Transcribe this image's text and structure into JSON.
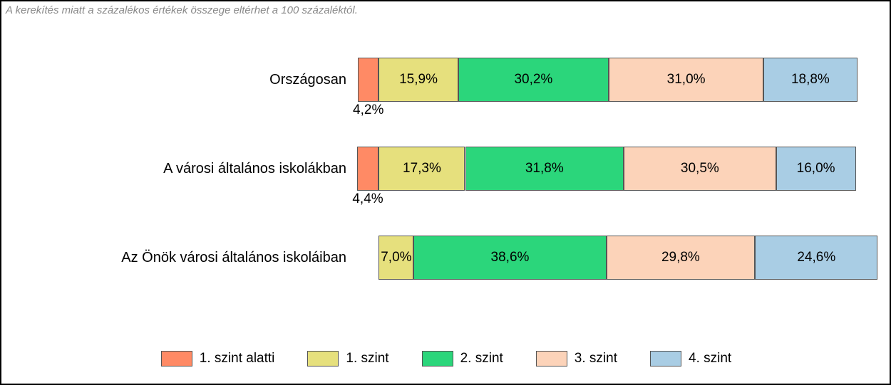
{
  "chart_data": {
    "type": "bar",
    "stacked": true,
    "orientation": "horizontal",
    "note": "A kerekítés miatt a százalékos értékek összege eltérhet a 100 százaléktól.",
    "unit": "%",
    "xlim": [
      0,
      100
    ],
    "left_anchor_value": 4.2,
    "categories": [
      "Országosan",
      "A városi általános iskolákban",
      "Az Önök városi általános iskoláiban"
    ],
    "series": [
      {
        "name": "1. szint alatti",
        "color": "#ff8a65",
        "values": [
          4.2,
          4.4,
          0.0
        ]
      },
      {
        "name": "1. szint",
        "color": "#e6e07d",
        "values": [
          15.9,
          17.3,
          7.0
        ]
      },
      {
        "name": "2. szint",
        "color": "#2bd67b",
        "values": [
          30.2,
          31.8,
          38.6
        ]
      },
      {
        "name": "3. szint",
        "color": "#fcd3b9",
        "values": [
          31.0,
          30.5,
          29.8
        ]
      },
      {
        "name": "4. szint",
        "color": "#a9cde4",
        "values": [
          18.8,
          16.0,
          24.6
        ]
      }
    ],
    "label_format": {
      "decimal_separator": ",",
      "decimals": 1,
      "suffix": "%"
    }
  }
}
